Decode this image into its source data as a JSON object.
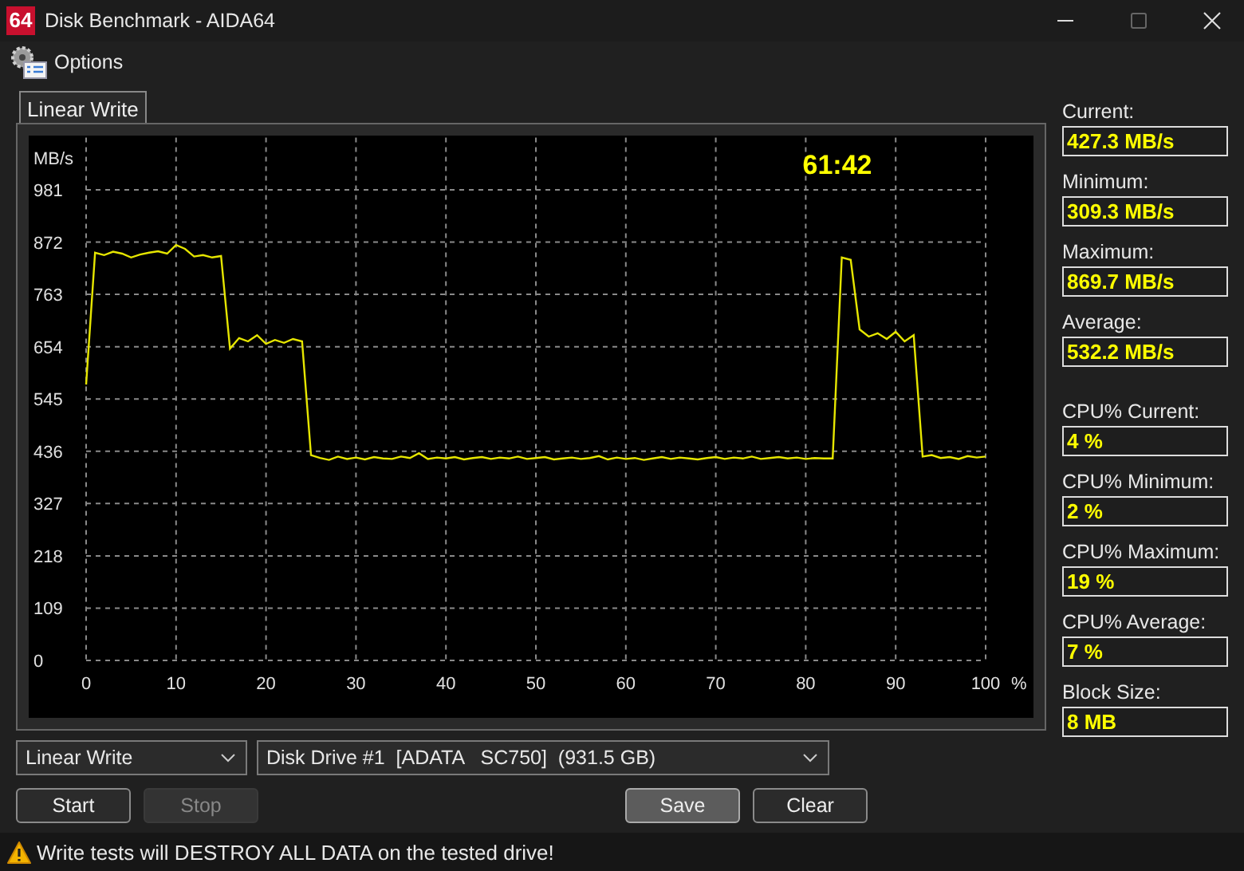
{
  "window": {
    "app_icon": "64",
    "title": "Disk Benchmark - AIDA64"
  },
  "toolbar": {
    "items": [
      {
        "label": "Options"
      }
    ]
  },
  "tabs": [
    {
      "label": "Linear Write",
      "selected": true
    }
  ],
  "chart": {
    "timer": "61:42",
    "chart_data": {
      "type": "line",
      "grid": true,
      "xlabel": "%",
      "ylabel": "MB/s",
      "xlim": [
        0,
        100
      ],
      "ylim": [
        0,
        1090
      ],
      "xticks": [
        0,
        10,
        20,
        30,
        40,
        50,
        60,
        70,
        80,
        90,
        100
      ],
      "yticks": [
        0,
        109,
        218,
        327,
        436,
        545,
        654,
        763,
        872,
        981
      ],
      "x": [
        0,
        1,
        2,
        3,
        4,
        5,
        6,
        7,
        8,
        9,
        10,
        11,
        12,
        13,
        14,
        15,
        16,
        17,
        18,
        19,
        20,
        21,
        22,
        23,
        24,
        25,
        26,
        27,
        28,
        29,
        30,
        31,
        32,
        33,
        34,
        35,
        36,
        37,
        38,
        39,
        40,
        41,
        42,
        43,
        44,
        45,
        46,
        47,
        48,
        49,
        50,
        51,
        52,
        53,
        54,
        55,
        56,
        57,
        58,
        59,
        60,
        61,
        62,
        63,
        64,
        65,
        66,
        67,
        68,
        69,
        70,
        71,
        72,
        73,
        74,
        75,
        76,
        77,
        78,
        79,
        80,
        81,
        82,
        83,
        84,
        85,
        86,
        87,
        88,
        89,
        90,
        91,
        92,
        93,
        94,
        95,
        96,
        97,
        98,
        99,
        100
      ],
      "series": [
        {
          "color": "#e6e600",
          "values": [
            575,
            850,
            845,
            852,
            848,
            840,
            846,
            850,
            853,
            848,
            866,
            858,
            842,
            845,
            840,
            843,
            650,
            672,
            665,
            678,
            660,
            668,
            662,
            670,
            665,
            428,
            422,
            418,
            425,
            420,
            423,
            419,
            424,
            421,
            420,
            425,
            422,
            432,
            420,
            423,
            421,
            424,
            419,
            422,
            424,
            420,
            423,
            421,
            425,
            420,
            422,
            424,
            419,
            421,
            423,
            420,
            422,
            426,
            419,
            423,
            420,
            422,
            418,
            421,
            424,
            420,
            423,
            421,
            419,
            422,
            424,
            420,
            423,
            421,
            425,
            420,
            422,
            424,
            421,
            423,
            420,
            422,
            421,
            421,
            840,
            835,
            690,
            675,
            682,
            670,
            685,
            665,
            678,
            425,
            428,
            422,
            424,
            420,
            426,
            423,
            425
          ]
        }
      ]
    }
  },
  "speed_readouts": [
    {
      "label": "Current:",
      "value": "427.3 MB/s"
    },
    {
      "label": "Minimum:",
      "value": "309.3 MB/s"
    },
    {
      "label": "Maximum:",
      "value": "869.7 MB/s"
    },
    {
      "label": "Average:",
      "value": "532.2 MB/s"
    }
  ],
  "cpu_readouts": [
    {
      "label": "CPU% Current:",
      "value": "4 %"
    },
    {
      "label": "CPU% Minimum:",
      "value": "2 %"
    },
    {
      "label": "CPU% Maximum:",
      "value": "19 %"
    },
    {
      "label": "CPU% Average:",
      "value": "7 %"
    },
    {
      "label": "Block Size:",
      "value": "8 MB"
    }
  ],
  "selectors": [
    {
      "value": "Linear Write"
    },
    {
      "value": "Disk Drive #1  [ADATA   SC750]  (931.5 GB)"
    }
  ],
  "run_buttons": [
    {
      "label": "Start",
      "disabled": false,
      "default": false
    },
    {
      "label": "Stop",
      "disabled": true,
      "default": false
    }
  ],
  "file_buttons": [
    {
      "label": "Save",
      "disabled": false,
      "default": true
    },
    {
      "label": "Clear",
      "disabled": false,
      "default": false
    }
  ],
  "status_bar": {
    "text": "Write tests will DESTROY ALL DATA on the tested drive!"
  }
}
